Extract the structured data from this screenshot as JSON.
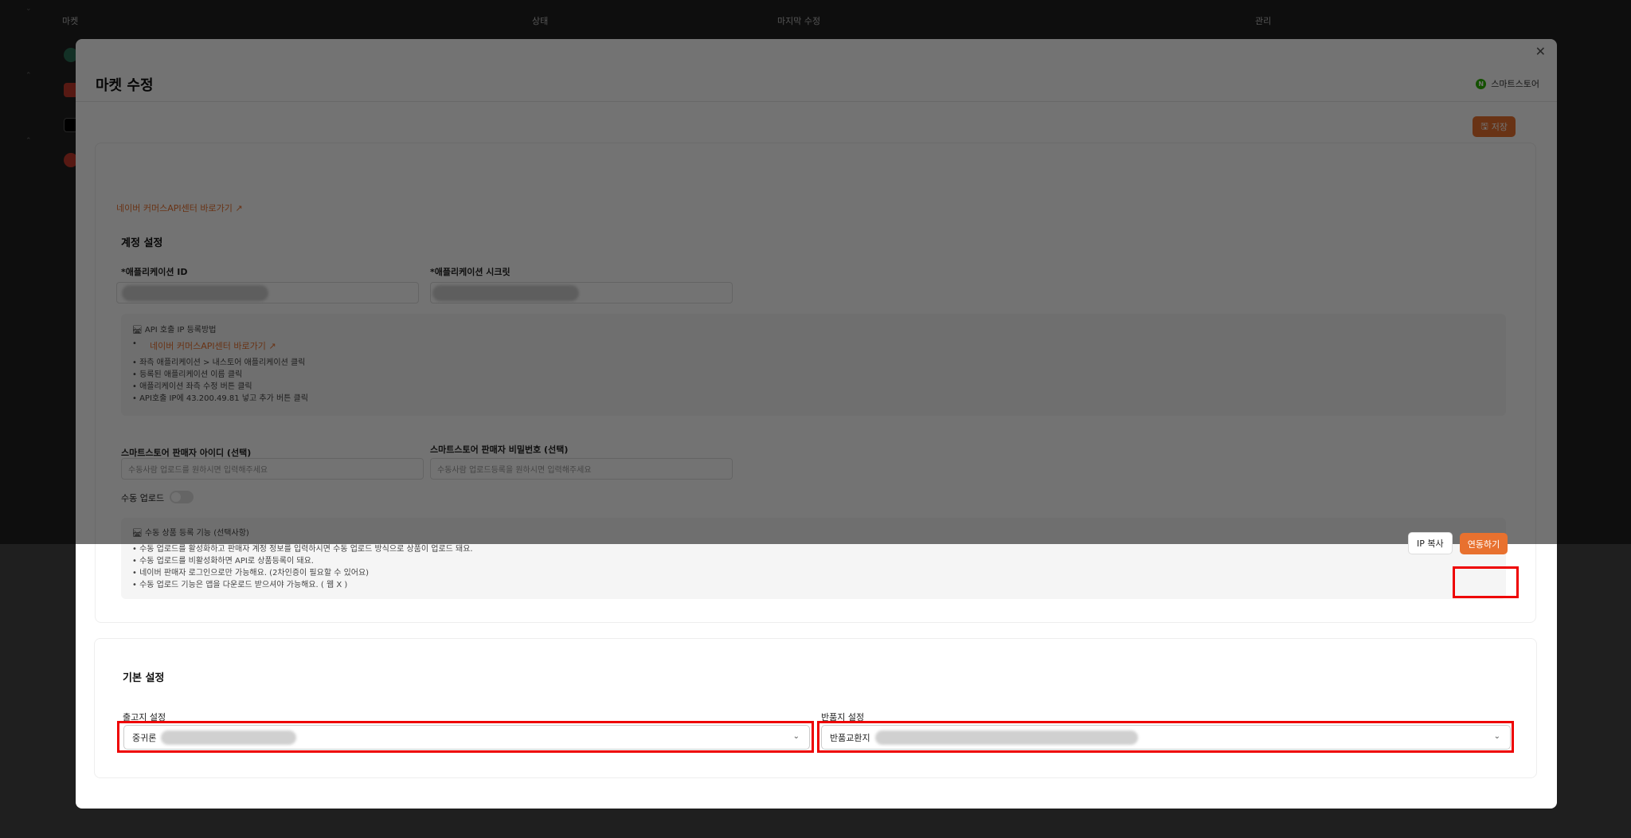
{
  "background": {
    "columns": [
      "마켓",
      "상태",
      "마지막 수정",
      "관리"
    ]
  },
  "modal": {
    "title": "마켓 수정",
    "market_badge": "스마트스토어",
    "save_label": "저장",
    "close_icon": "close-icon"
  },
  "account_card": {
    "api_link": "네이버 커머스API센터 바로가기",
    "section_title": "계정 설정",
    "app_id_label": "*애플리케이션 ID",
    "app_secret_label": "*애플리케이션 시크릿",
    "ip_guide": {
      "title": "🛤 API 호출 IP 등록방법",
      "link": "네이버 커머스API센터 바로가기",
      "steps": [
        "• 좌측 애플리케이션 > 내스토어 애플리케이션 클릭",
        "• 등록된 애플리케이션 이름 클릭",
        "• 애플리케이션 좌측 수정 버튼 클릭",
        "• API호출 IP에 43.200.49.81 넣고 추가 버튼 클릭"
      ]
    },
    "seller_id_label": "스마트스토어 판매자 아이디 (선택)",
    "seller_id_placeholder": "수동사람 업로드를 원하시면 입력해주세요",
    "seller_pw_label": "스마트스토어 판매자 비밀번호 (선택)",
    "seller_pw_placeholder": "수동사람 업로드등록을 원하시면 입력해주세요",
    "manual_upload_label": "수동 업로드",
    "manual_upload_enabled": false,
    "manual_guide": {
      "title": "🛤 수동 상품 등록 기능 (선택사항)",
      "lines": [
        "• 수동 업로드를 활성화하고 판매자 계정 정보를 입력하시면 수동 업로드 방식으로 상품이 업로드 돼요.",
        "• 수동 업로드를 비활성화하면 API로 상품등록이 돼요.",
        "• 네이버 판매자 로그인으로만 가능해요. (2차인증이 필요할 수 있어요)",
        "• 수동 업로드 기능은 앱을 다운로드 받으셔야 가능해요. ( 웹 X )"
      ]
    },
    "ip_copy_label": "IP 복사",
    "connect_label": "연동하기"
  },
  "basic_card": {
    "section_title": "기본 설정",
    "shipping_label": "출고지 설정",
    "shipping_value_prefix": "중귀론",
    "return_label": "반품지 설정",
    "return_value_prefix": "반품교환지"
  }
}
